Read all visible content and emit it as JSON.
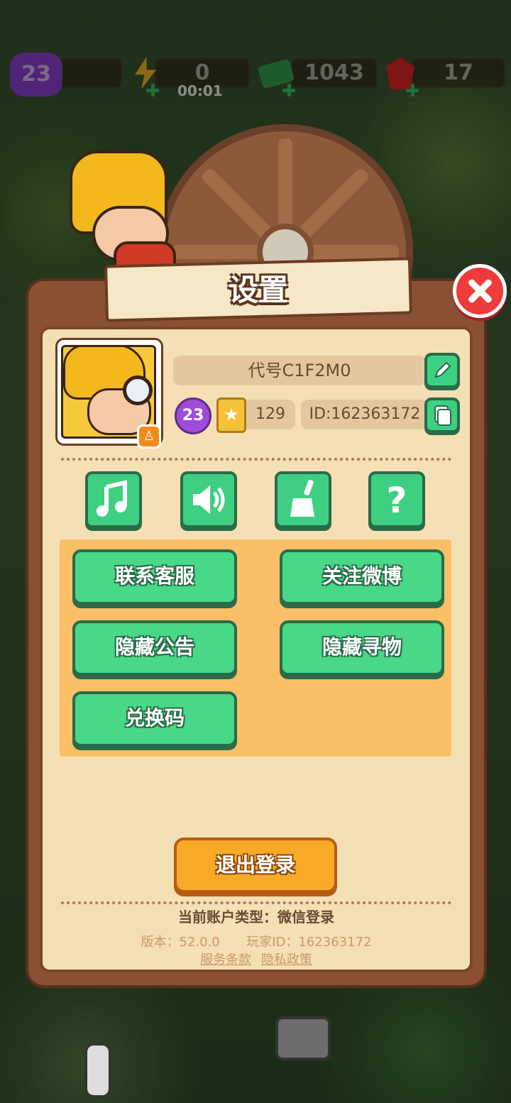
{
  "hud": {
    "level": "23",
    "energy_value": "0",
    "energy_timer": "00:01",
    "cash_value": "1043",
    "gem_value": "17"
  },
  "dialog": {
    "title": "设置",
    "profile": {
      "name": "代号C1F2M0",
      "level": "23",
      "cards": "129",
      "id_label": "ID:162363172"
    },
    "icon_buttons": [
      "music-icon",
      "sound-icon",
      "broom-icon",
      "help-icon"
    ],
    "menu_buttons": {
      "contact": "联系客服",
      "weibo": "关注微博",
      "hide_notice": "隐藏公告",
      "hide_find": "隐藏寻物",
      "redeem": "兑换码"
    },
    "logout_label": "退出登录",
    "account_type": "当前账户类型：微信登录",
    "version": "版本：52.0.0",
    "player_id": "玩家ID：162363172",
    "terms_link": "服务条款",
    "privacy_link": "隐私政策"
  },
  "colors": {
    "panel_brown": "#8a5034",
    "panel_cream": "#f5dfb5",
    "button_green": "#48d887",
    "button_orange": "#f7a928",
    "close_red": "#ee3b3b"
  }
}
